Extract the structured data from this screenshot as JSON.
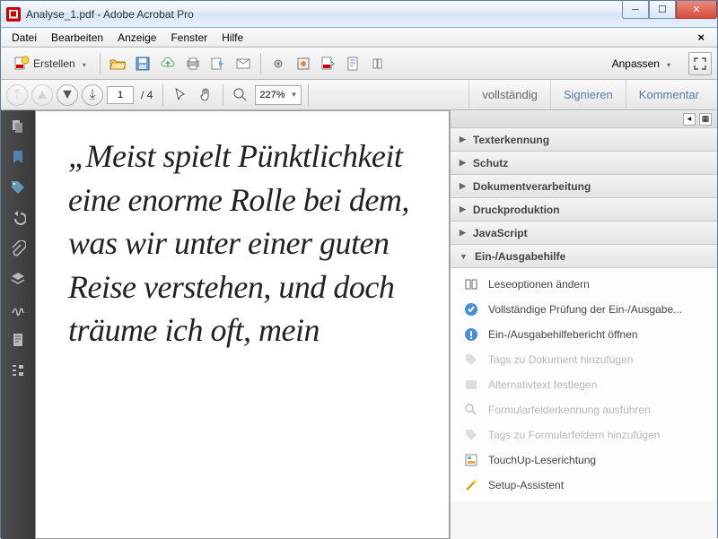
{
  "window": {
    "title": "Analyse_1.pdf - Adobe Acrobat Pro"
  },
  "menu": {
    "items": [
      "Datei",
      "Bearbeiten",
      "Anzeige",
      "Fenster",
      "Hilfe"
    ]
  },
  "toolbar": {
    "create": "Erstellen",
    "customize": "Anpassen"
  },
  "nav": {
    "page": "1",
    "total": "/ 4",
    "zoom": "227%"
  },
  "righttabs": {
    "full": "vollständig",
    "sign": "Signieren",
    "comment": "Kommentar"
  },
  "panel": {
    "sections": [
      "Texterkennung",
      "Schutz",
      "Dokumentverarbeitung",
      "Druckproduktion",
      "JavaScript",
      "Ein-/Ausgabehilfe"
    ],
    "items": {
      "a": "Leseoptionen ändern",
      "b": "Vollständige Prüfung der Ein-/Ausgabe...",
      "c": "Ein-/Ausgabehilfebericht öffnen",
      "d": "Tags zu Dokument hinzufügen",
      "e": "Alternativtext festlegen",
      "f": "Formularfelderkennung ausführen",
      "g": "Tags zu Formularfeldern hinzufügen",
      "h": "TouchUp-Leserichtung",
      "i": "Setup-Assistent"
    }
  },
  "document": {
    "text": "„Meist spielt Pünktlichkeit eine enorme Rolle bei dem, was wir unter einer guten Reise verstehen, und doch träume ich oft, mein"
  }
}
